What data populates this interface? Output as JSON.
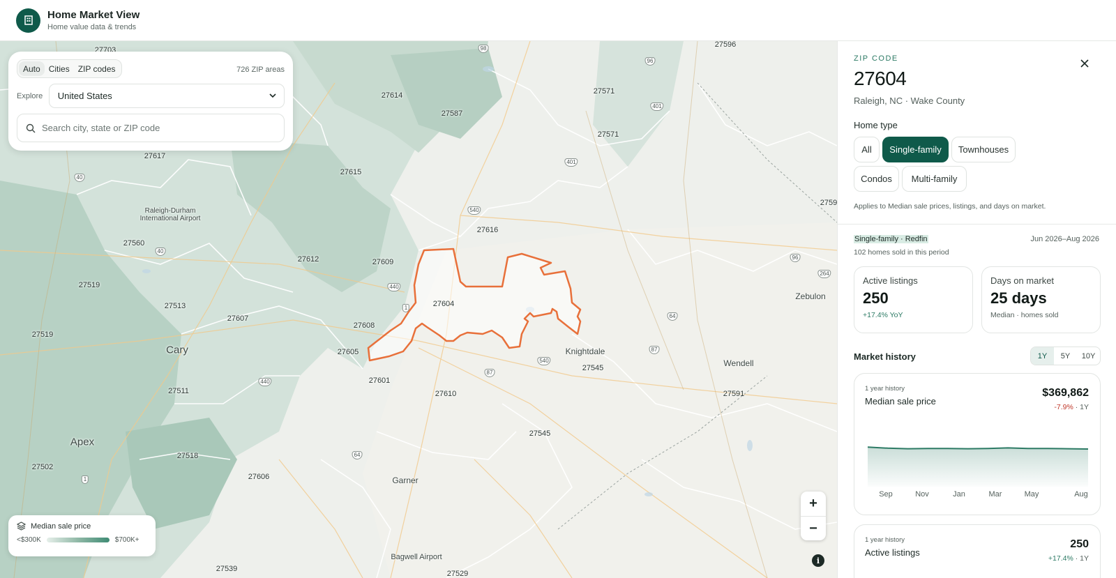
{
  "header": {
    "title": "Home Market View",
    "subtitle": "Home value data & trends",
    "logo_icon": "building-icon"
  },
  "controls": {
    "modes": [
      "Auto",
      "Cities",
      "ZIP codes"
    ],
    "active_mode": "Auto",
    "zip_count": "726 ZIP areas",
    "explore_label": "Explore",
    "explore_value": "United States",
    "search_placeholder": "Search city, state or ZIP code"
  },
  "legend": {
    "title": "Median sale price",
    "min": "<$300K",
    "max": "$700K+"
  },
  "zoom": {
    "in": "+",
    "out": "−",
    "info": "i"
  },
  "map": {
    "zip_labels": [
      "27703",
      "27596",
      "27614",
      "27571",
      "27587",
      "27571",
      "27617",
      "27615",
      "27616",
      "27560",
      "27612",
      "27609",
      "27519",
      "27513",
      "27604",
      "27607",
      "27608",
      "27519",
      "27605",
      "27545",
      "27601",
      "27610",
      "27511",
      "27591",
      "27545",
      "27518",
      "27502",
      "27606",
      "27539",
      "27529",
      "2759"
    ],
    "city_labels": [
      "Cary",
      "Apex",
      "Knightdale",
      "Wendell",
      "Zebulon",
      "Garner",
      "Bagwell Airport",
      "Raleigh-Durham International Airport"
    ],
    "road_shields": [
      "98",
      "96",
      "401",
      "401",
      "540",
      "440",
      "1",
      "87",
      "540",
      "64",
      "87",
      "96",
      "264",
      "440",
      "64",
      "1",
      "40",
      "40"
    ],
    "selected_zip": "27604",
    "colors": {
      "selection": "#e8703a",
      "accent": "#0f5a4a"
    }
  },
  "panel": {
    "eyebrow": "ZIP CODE",
    "zip": "27604",
    "location": "Raleigh, NC · Wake County",
    "home_type_label": "Home type",
    "home_types": [
      "All",
      "Single-family",
      "Townhouses",
      "Condos",
      "Multi-family"
    ],
    "active_home_type": "Single-family",
    "note": "Applies to Median sale prices, listings, and days on market.",
    "source": "Single-family · Redfin",
    "period": "Jun 2026–Aug 2026",
    "sold": "102 homes sold in this period",
    "stats": [
      {
        "label": "Active listings",
        "value": "250",
        "sub": "+17.4% YoY"
      },
      {
        "label": "Days on market",
        "value": "25 days",
        "sub": "Median · homes sold"
      }
    ],
    "market_history_title": "Market history",
    "ranges": [
      "1Y",
      "5Y",
      "10Y"
    ],
    "active_range": "1Y",
    "history": [
      {
        "eyebrow": "1 year history",
        "name": "Median sale price",
        "value": "$369,862",
        "change": "-7.9%",
        "change_suffix": " · 1Y"
      },
      {
        "eyebrow": "1 year history",
        "name": "Active listings",
        "value": "250",
        "change": "+17.4%",
        "change_suffix": " · 1Y"
      }
    ],
    "months": [
      "Sep",
      "Nov",
      "Jan",
      "Mar",
      "May",
      "Aug"
    ]
  },
  "chart_data": {
    "type": "area",
    "title": "Median sale price",
    "x": [
      "Sep",
      "Oct",
      "Nov",
      "Dec",
      "Jan",
      "Feb",
      "Mar",
      "Apr",
      "May",
      "Jun",
      "Jul",
      "Aug"
    ],
    "values": [
      382000,
      378000,
      376000,
      377000,
      377000,
      376000,
      377000,
      379000,
      377000,
      377000,
      376000,
      375000
    ],
    "ylim": [
      0,
      450000
    ],
    "color": "#2c7a64"
  }
}
